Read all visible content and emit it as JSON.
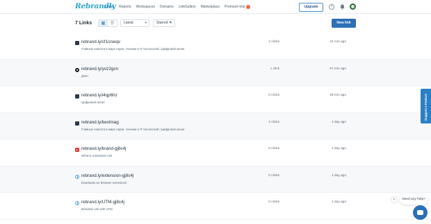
{
  "app": {
    "logo": "Rebrandly",
    "nav": [
      "Links",
      "Reports",
      "Workspaces",
      "Domains",
      "LinkGallery",
      "Marketplace"
    ],
    "premium_label": "Premium trial",
    "upgrade_label": "Upgrade"
  },
  "toolbar": {
    "links_count": "7 Links",
    "sort_value": "Latest",
    "starred_label": "Starred",
    "new_link_label": "New link"
  },
  "links": [
    {
      "title": "rebrand.ly/cf1cnwqv",
      "desc": "Главные новости в мире науки, техники и IT-технологий | Цифровой океан",
      "clicks": "2 clicks",
      "time": "24 min ago",
      "favicon": "square-icon"
    },
    {
      "title": "rebrand.ly/yoz2gcn",
      "desc": "Дзен",
      "clicks": "1 click",
      "time": "27 min ago",
      "favicon": "zen-icon"
    },
    {
      "title": "rebrand.ly/i4qp6hz",
      "desc": "Цифровой океан",
      "clicks": "0 clicks",
      "time": "28 min ago",
      "favicon": "square-icon"
    },
    {
      "title": "rebrand.ly/bestmag",
      "desc": "Главные новости в мире науки, техники и IT-технологий | Цифровой океан",
      "clicks": "2 clicks",
      "time": "1 day ago",
      "favicon": "square-icon"
    },
    {
      "title": "rebrand.ly/brand-gj8c4j",
      "desc": "What is a Branded Link",
      "clicks": "0 clicks",
      "time": "1 day ago",
      "favicon": "youtube-icon"
    },
    {
      "title": "rebrand.ly/extension-gj8c4j",
      "desc": "Download our Browser extensions",
      "clicks": "0 clicks",
      "time": "1 day ago",
      "favicon": "globe-icon"
    },
    {
      "title": "rebrand.ly/UTM-gj8c4j",
      "desc": "Branded Link with UTM",
      "clicks": "0 clicks",
      "time": "1 day ago",
      "favicon": "globe-icon"
    }
  ],
  "side_tab": "Suggest a Feature",
  "chat": {
    "close": "×",
    "message": "Need any help?"
  }
}
